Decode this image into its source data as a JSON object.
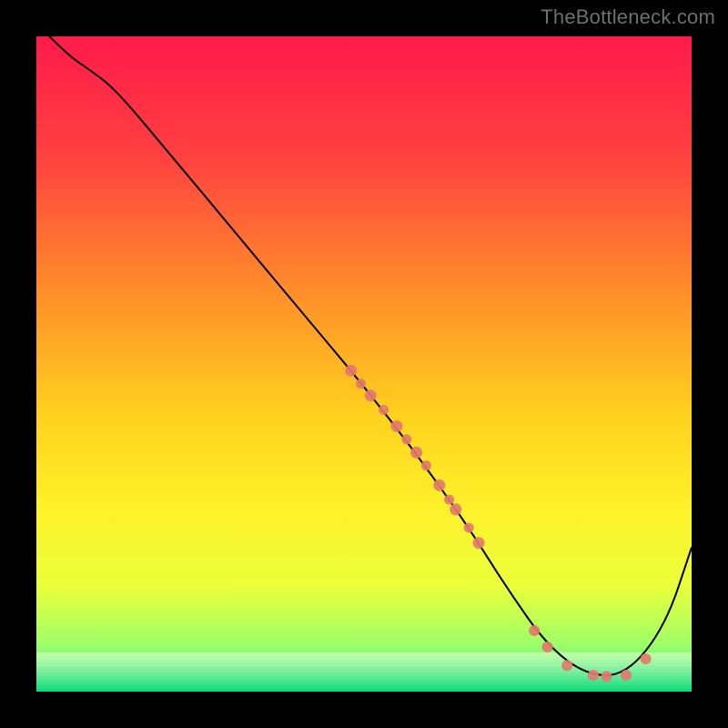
{
  "watermark": "TheBottleneck.com",
  "chart_data": {
    "type": "line",
    "title": "",
    "xlabel": "",
    "ylabel": "",
    "xlim": [
      0,
      100
    ],
    "ylim": [
      0,
      100
    ],
    "grid": false,
    "legend": null,
    "series": [
      {
        "name": "bottleneck-curve",
        "x": [
          2,
          5,
          8,
          12,
          20,
          30,
          40,
          48,
          54,
          60,
          66,
          72,
          78,
          84,
          90,
          96,
          100
        ],
        "y": [
          100,
          97,
          95,
          92,
          82.5,
          70.5,
          58.5,
          49,
          41.5,
          33.5,
          25,
          15.5,
          7,
          2.5,
          2.5,
          10,
          22
        ],
        "stroke": "#000000",
        "stroke_width": 2
      }
    ],
    "scatter": [
      {
        "name": "data-point",
        "x": 48,
        "y": 49,
        "r": 6.5,
        "fill": "#e27a6e"
      },
      {
        "name": "data-point",
        "x": 49.5,
        "y": 47,
        "r": 5.5,
        "fill": "#e27a6e"
      },
      {
        "name": "data-point",
        "x": 51,
        "y": 45.2,
        "r": 6.5,
        "fill": "#e27a6e"
      },
      {
        "name": "data-point",
        "x": 53,
        "y": 43,
        "r": 5.5,
        "fill": "#e27a6e"
      },
      {
        "name": "data-point",
        "x": 55,
        "y": 40.5,
        "r": 6.5,
        "fill": "#e27a6e"
      },
      {
        "name": "data-point",
        "x": 56.5,
        "y": 38.5,
        "r": 5.5,
        "fill": "#e27a6e"
      },
      {
        "name": "data-point",
        "x": 58,
        "y": 36.5,
        "r": 6.5,
        "fill": "#e27a6e"
      },
      {
        "name": "data-point",
        "x": 59.5,
        "y": 34.5,
        "r": 5.5,
        "fill": "#e27a6e"
      },
      {
        "name": "data-point",
        "x": 61.5,
        "y": 31.5,
        "r": 6.5,
        "fill": "#e27a6e"
      },
      {
        "name": "data-point",
        "x": 63,
        "y": 29.3,
        "r": 5.5,
        "fill": "#e27a6e"
      },
      {
        "name": "data-point",
        "x": 64,
        "y": 27.8,
        "r": 6.5,
        "fill": "#e27a6e"
      },
      {
        "name": "data-point",
        "x": 66,
        "y": 25,
        "r": 5.5,
        "fill": "#e27a6e"
      },
      {
        "name": "data-point",
        "x": 67.5,
        "y": 22.7,
        "r": 6.5,
        "fill": "#e27a6e"
      },
      {
        "name": "data-point",
        "x": 76,
        "y": 9.3,
        "r": 6.0,
        "fill": "#e27a6e"
      },
      {
        "name": "data-point",
        "x": 78,
        "y": 6.8,
        "r": 6.0,
        "fill": "#e27a6e"
      },
      {
        "name": "data-point",
        "x": 81,
        "y": 4,
        "r": 6.0,
        "fill": "#e27a6e"
      },
      {
        "name": "data-point",
        "x": 85,
        "y": 2.5,
        "r": 6.0,
        "fill": "#e27a6e"
      },
      {
        "name": "data-point",
        "x": 87,
        "y": 2.3,
        "r": 6.0,
        "fill": "#e27a6e"
      },
      {
        "name": "data-point",
        "x": 90,
        "y": 2.5,
        "r": 6.0,
        "fill": "#e27a6e"
      },
      {
        "name": "data-point",
        "x": 93,
        "y": 5,
        "r": 6.0,
        "fill": "#e27a6e"
      }
    ],
    "background_gradient": {
      "stops": [
        {
          "offset": 0.0,
          "color": "#ff1a4b"
        },
        {
          "offset": 0.18,
          "color": "#ff4040"
        },
        {
          "offset": 0.38,
          "color": "#ff8a2a"
        },
        {
          "offset": 0.58,
          "color": "#ffd21e"
        },
        {
          "offset": 0.72,
          "color": "#fff12a"
        },
        {
          "offset": 0.84,
          "color": "#e9ff3a"
        },
        {
          "offset": 0.93,
          "color": "#9cff6a"
        },
        {
          "offset": 1.0,
          "color": "#17e37f"
        }
      ]
    },
    "bottom_band": {
      "from_y": 0,
      "to_y": 6,
      "n_stripes": 12
    }
  }
}
